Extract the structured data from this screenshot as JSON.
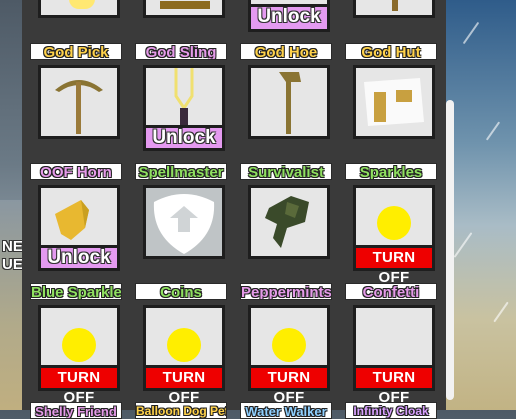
{
  "side": {
    "line1": "NEW",
    "line2": "UEST"
  },
  "row0": {
    "unlock_label": "Unlock"
  },
  "items": [
    {
      "name": "God Pick",
      "button": null
    },
    {
      "name": "God Sling",
      "button": "Unlock"
    },
    {
      "name": "God Hoe",
      "button": null
    },
    {
      "name": "God Hut",
      "button": null
    },
    {
      "name": "OOF Horn",
      "button": "Unlock"
    },
    {
      "name": "Spellmaster",
      "button": null
    },
    {
      "name": "Survivalist",
      "button": null
    },
    {
      "name": "Sparkles",
      "button": "TURN OFF"
    },
    {
      "name": "Blue Sparkles",
      "button": "TURN OFF"
    },
    {
      "name": "Coins",
      "button": "TURN OFF"
    },
    {
      "name": "Peppermints",
      "button": "TURN OFF"
    },
    {
      "name": "Confetti",
      "button": "TURN OFF"
    }
  ],
  "row4": [
    "Shelly Friend",
    "Balloon Dog Pet",
    "Water Walker",
    "Infinity Cloak"
  ],
  "icons": {
    "god_pick": "pickaxe-icon",
    "god_sling": "slingshot-icon",
    "god_hoe": "hoe-icon",
    "god_hut": "hut-icon",
    "oof_horn": "horn-icon",
    "spellmaster": "spellmaster-emblem-icon",
    "survivalist": "survivalist-plant-icon",
    "effect": "yellow-dot-icon"
  },
  "colors": {
    "unlock": "#e49af0",
    "turn_off": "#ee0000",
    "dot": "#ffee00",
    "panel": "#3a3a3a"
  }
}
